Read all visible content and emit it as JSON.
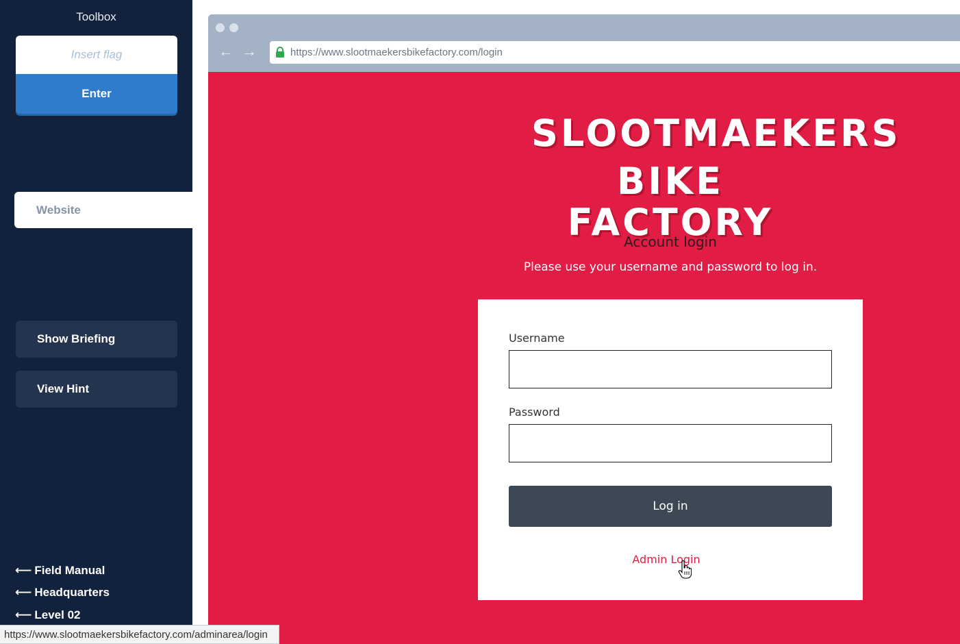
{
  "sidebar": {
    "title": "Toolbox",
    "flag_placeholder": "Insert flag",
    "enter_label": "Enter",
    "tab_label": "Website",
    "briefing_label": "Show Briefing",
    "hint_label": "View Hint",
    "nav_links": [
      "Field Manual",
      "Headquarters",
      "Level 02"
    ],
    "back_arrow": "⟵"
  },
  "browser": {
    "url": "https://www.slootmaekersbikefactory.com/login",
    "back_icon": "←",
    "forward_icon": "→"
  },
  "site": {
    "brand_line1": "SLOOTMAEKERS",
    "brand_line2": "BIKE FACTORY",
    "heading": "Account login",
    "subheading": "Please use your username and password to log in.",
    "username_label": "Username",
    "password_label": "Password",
    "login_button": "Log in",
    "admin_link": "Admin Login",
    "brand_color": "#e11c45"
  },
  "statusbar": {
    "url": "https://www.slootmaekersbikefactory.com/adminarea/login"
  }
}
